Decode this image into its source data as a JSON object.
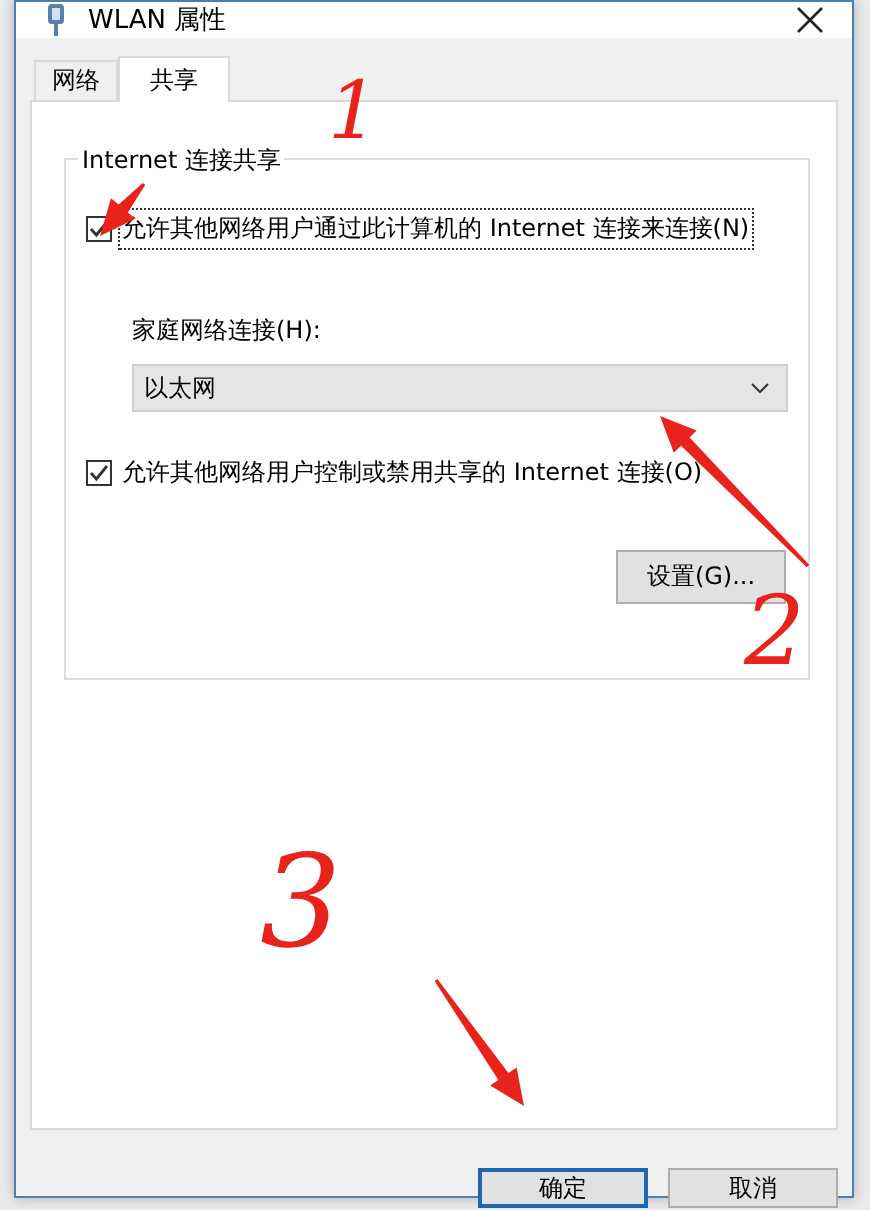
{
  "window": {
    "title": "WLAN 属性"
  },
  "tabs": [
    {
      "label": "网络",
      "selected": false
    },
    {
      "label": "共享",
      "selected": true
    }
  ],
  "group": {
    "title": "Internet 连接共享",
    "allow_sharing": {
      "label": "允许其他网络用户通过此计算机的 Internet 连接来连接(N)",
      "checked": true,
      "focused": true
    },
    "home_connection": {
      "label": "家庭网络连接(H):",
      "value": "以太网"
    },
    "allow_control": {
      "label": "允许其他网络用户控制或禁用共享的 Internet 连接(O)",
      "checked": true,
      "focused": false
    },
    "settings_button": "设置(G)..."
  },
  "buttons": [
    {
      "label": "确定",
      "default": true
    },
    {
      "label": "取消",
      "default": false
    }
  ],
  "annotations": [
    {
      "kind": "number",
      "text": "1"
    },
    {
      "kind": "arrow"
    },
    {
      "kind": "arrow"
    },
    {
      "kind": "number",
      "text": "2"
    },
    {
      "kind": "number",
      "text": "3"
    },
    {
      "kind": "arrow"
    }
  ]
}
